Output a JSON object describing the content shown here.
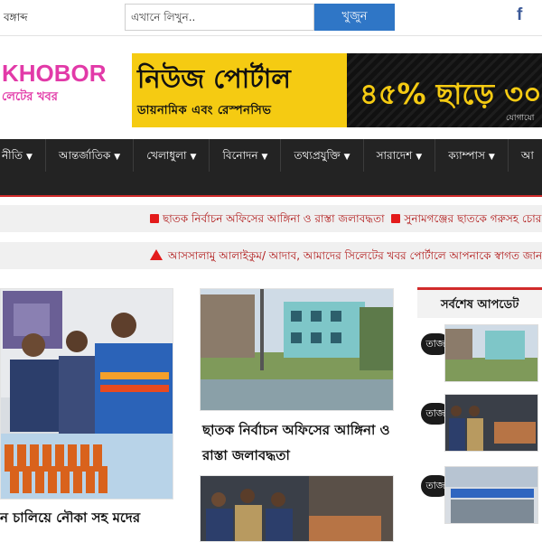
{
  "topbar": {
    "date_label": "বঙ্গাব্দ",
    "search_placeholder": "এখানে লিখুন..",
    "search_button": "খুজুন",
    "facebook_icon_label": "f"
  },
  "logo": {
    "main": "KHOBOR",
    "sub": "লেটের খবর"
  },
  "banner": {
    "title": "নিউজ পোর্টাল",
    "subtitle": "ডায়নামিক এবং রেস্পনসিভ",
    "offer": "৪৫% ছাড়ে ৩০",
    "small": "যোগাযো"
  },
  "nav": {
    "items": [
      {
        "label": "নীতি"
      },
      {
        "label": "আন্তর্জাতিক"
      },
      {
        "label": "খেলাধুলা"
      },
      {
        "label": "বিনোদন"
      },
      {
        "label": "তথ্যপ্রযুক্তি"
      },
      {
        "label": "সারাদেশ"
      },
      {
        "label": "ক্যাম্পাস"
      },
      {
        "label": "আ"
      }
    ]
  },
  "ticker1": {
    "items": [
      "ছাতক নির্বাচন অফিসের আঙ্গিনা ও রাস্তা জলাবদ্ধতা",
      "সুনামগঞ্জের ছাতকে গরুসহ চোর গ্র"
    ]
  },
  "ticker2": {
    "text": "আসসালামু আলাইকুম/ আদাব, আমাদের সিলেটের খবর পোর্টালে আপনাকে স্বাগত জানা"
  },
  "lead": {
    "title": "ন চালিয়ে নৌকা সহ মদের"
  },
  "card1": {
    "title": "ছাতক নির্বাচন অফিসের আঙ্গিনা ও রাস্তা জলাবদ্ধতা"
  },
  "sidebar": {
    "heading": "সর্বশেষ আপডেট",
    "items": [
      {
        "tag": "তাজ"
      },
      {
        "tag": "তাজ"
      },
      {
        "tag": "তাজ"
      }
    ]
  },
  "colors": {
    "accent_red": "#d12b2b",
    "nav_bg": "#232323",
    "button_blue": "#2f76c6",
    "logo_pink": "#e23aa8",
    "banner_yellow": "#f5cb12"
  }
}
